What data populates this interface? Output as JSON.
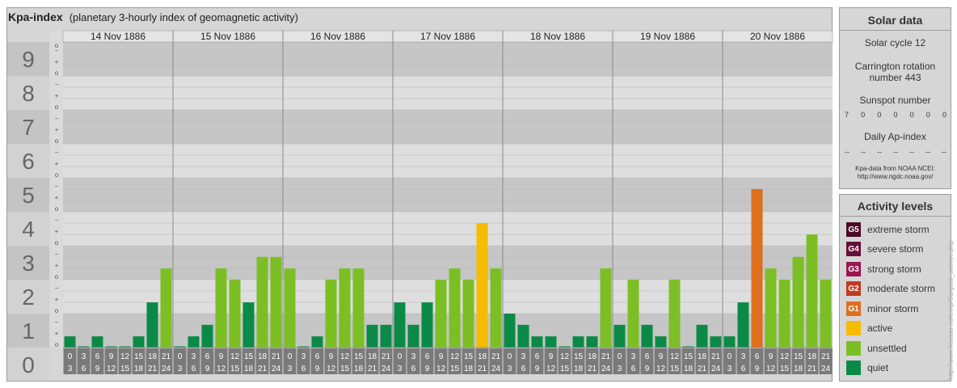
{
  "header": {
    "title": "Kpa-index",
    "subtitle": "(planetary 3-hourly index of geomagnetic activity)"
  },
  "chart_data": {
    "type": "bar",
    "title": "Kpa-index",
    "subtitle": "(planetary 3-hourly index of geomagnetic activity)",
    "ylim": [
      0,
      9
    ],
    "y_ticks": [
      "0",
      "1",
      "2",
      "3",
      "4",
      "5",
      "6",
      "7",
      "8",
      "9"
    ],
    "minor_tick_labels": [
      "o",
      "+",
      "−"
    ],
    "days": [
      "14 Nov 1886",
      "15 Nov 1886",
      "16 Nov 1886",
      "17 Nov 1886",
      "18 Nov 1886",
      "19 Nov 1886",
      "20 Nov 1886"
    ],
    "interval_labels": [
      [
        "0",
        "3"
      ],
      [
        "3",
        "6"
      ],
      [
        "6",
        "9"
      ],
      [
        "9",
        "12"
      ],
      [
        "12",
        "15"
      ],
      [
        "15",
        "18"
      ],
      [
        "18",
        "21"
      ],
      [
        "21",
        "24"
      ]
    ],
    "values": [
      [
        0.33,
        0,
        0.33,
        0,
        0,
        0.33,
        1.33,
        2.33
      ],
      [
        0,
        0.33,
        0.67,
        2.33,
        2,
        1.33,
        2.67,
        2.67
      ],
      [
        2.33,
        0,
        0.33,
        2,
        2.33,
        2.33,
        0.67,
        0.67
      ],
      [
        1.33,
        0.67,
        1.33,
        2,
        2.33,
        2,
        3.67,
        2.33
      ],
      [
        1,
        0.67,
        0.33,
        0.33,
        0,
        0.33,
        0.33,
        2.33
      ],
      [
        0.67,
        2,
        0.67,
        0.33,
        2,
        0,
        0.67,
        0.33
      ],
      [
        0.33,
        1.33,
        4.67,
        2.33,
        2,
        2.67,
        3.33,
        2
      ]
    ],
    "levels": [
      [
        7,
        7,
        7,
        7,
        7,
        7,
        7,
        6
      ],
      [
        7,
        7,
        7,
        6,
        6,
        7,
        6,
        6
      ],
      [
        6,
        7,
        7,
        6,
        6,
        6,
        7,
        7
      ],
      [
        7,
        7,
        7,
        6,
        6,
        6,
        5,
        6
      ],
      [
        7,
        7,
        7,
        7,
        7,
        7,
        7,
        6
      ],
      [
        7,
        6,
        7,
        7,
        6,
        7,
        7,
        7
      ],
      [
        7,
        7,
        4,
        6,
        6,
        6,
        6,
        6
      ]
    ]
  },
  "colors": {
    "panel_bg": "#d6d6d6",
    "band_dark": "#c6c6c6",
    "band_light": "#dedede",
    "levels": [
      "#4a0a26",
      "#64103a",
      "#9a1654",
      "#c23a20",
      "#de6f1d",
      "#f5bc00",
      "#7cbf24",
      "#0a8a46"
    ]
  },
  "solar": {
    "title": "Solar data",
    "cycle": "Solar cycle 12",
    "carrington_line1": "Carrington rotation",
    "carrington_line2": "number 443",
    "sunspot_title": "Sunspot number",
    "sunspot_values": [
      "7",
      "0",
      "0",
      "0",
      "0",
      "0",
      "0"
    ],
    "ap_title": "Daily Ap-index",
    "ap_values": [
      "--",
      "--",
      "--",
      "--",
      "--",
      "--",
      "--"
    ],
    "source_line1": "Kpa-data from NOAA NCEI:",
    "source_line2": "http://www.ngdc.noaa.gov/"
  },
  "activity": {
    "title": "Activity levels",
    "items": [
      {
        "code": "G5",
        "label": "extreme storm"
      },
      {
        "code": "G4",
        "label": "severe storm"
      },
      {
        "code": "G3",
        "label": "strong storm"
      },
      {
        "code": "G2",
        "label": "moderate storm"
      },
      {
        "code": "G1",
        "label": "minor storm"
      },
      {
        "code": "",
        "label": "active"
      },
      {
        "code": "",
        "label": "unsettled"
      },
      {
        "code": "",
        "label": "quiet"
      }
    ]
  },
  "watermark": "http://www.fleussu.eu/temp/Surgical_archive.php"
}
